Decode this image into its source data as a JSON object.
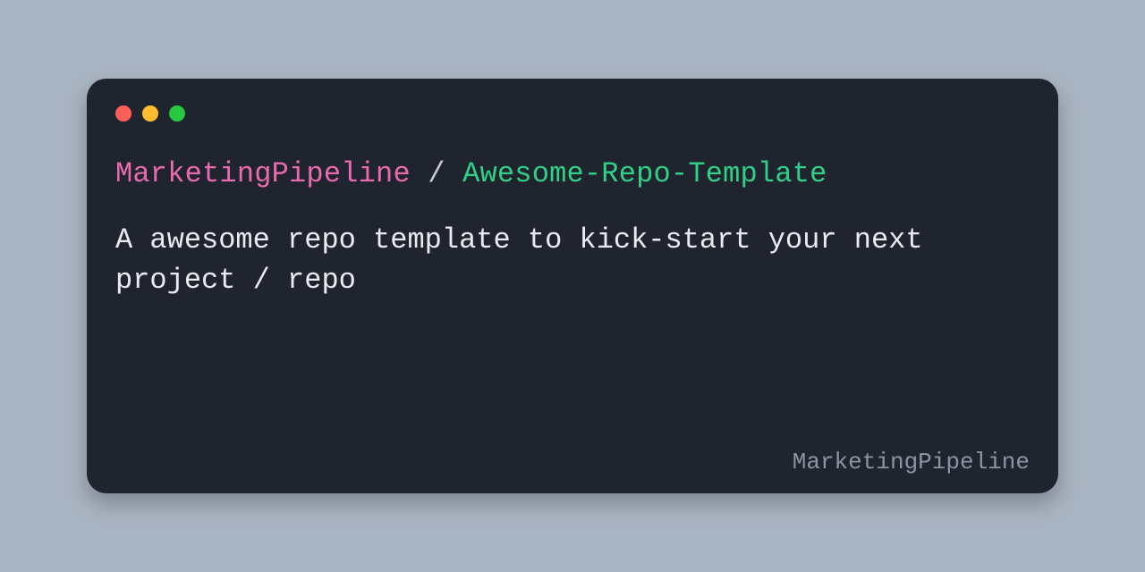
{
  "header": {
    "owner": "MarketingPipeline",
    "separator": " / ",
    "repo": "Awesome-Repo-Template"
  },
  "description": "A awesome repo template to kick-start your next project / repo",
  "footer": {
    "brand": "MarketingPipeline"
  }
}
